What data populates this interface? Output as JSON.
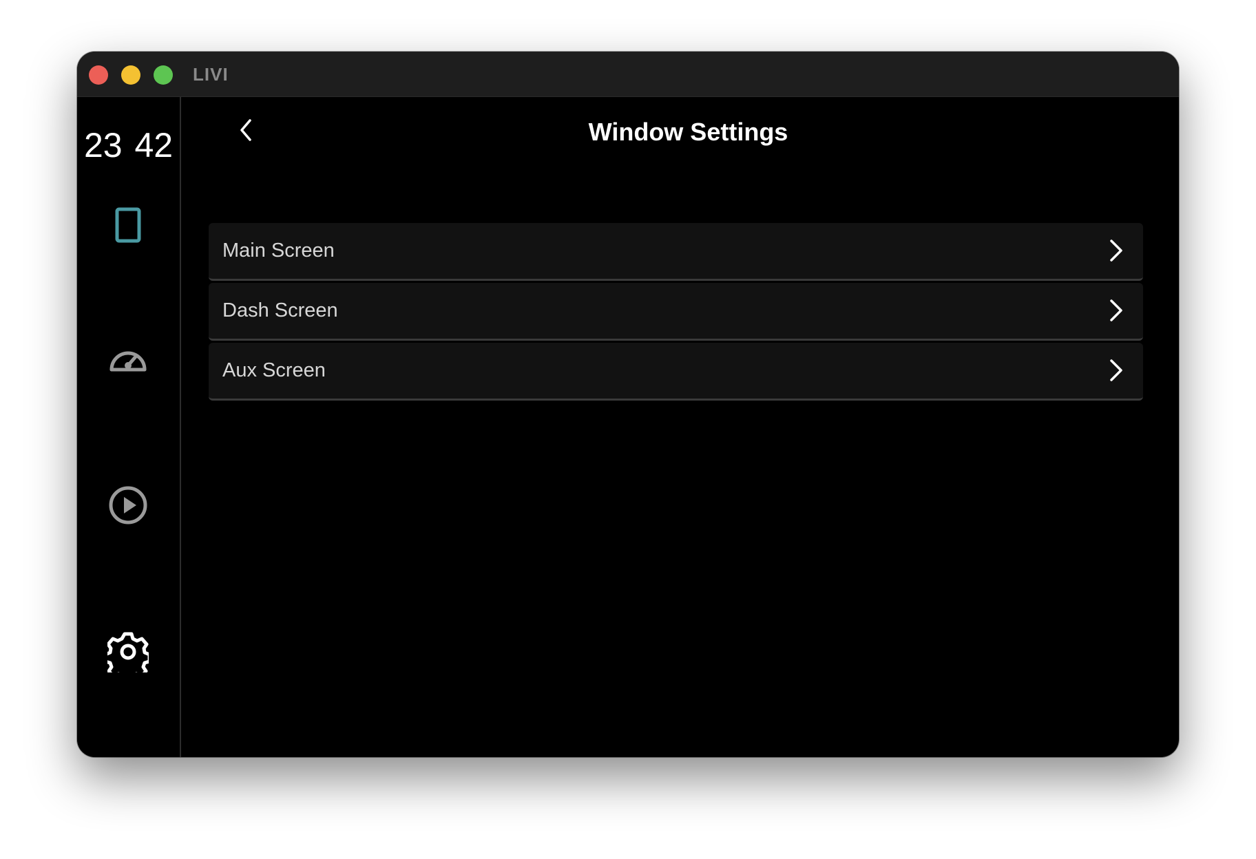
{
  "window": {
    "title": "LIVI"
  },
  "sidebar": {
    "clock": "23 42",
    "items": [
      {
        "icon": "phone-icon",
        "color": "#4a9aa3"
      },
      {
        "icon": "speedometer-icon",
        "color": "#9a9a9a"
      },
      {
        "icon": "play-circle-icon",
        "color": "#9a9a9a"
      },
      {
        "icon": "gear-icon",
        "color": "#ffffff"
      }
    ]
  },
  "main": {
    "title": "Window Settings",
    "items": [
      {
        "label": "Main Screen"
      },
      {
        "label": "Dash Screen"
      },
      {
        "label": "Aux Screen"
      }
    ]
  },
  "colors": {
    "accent": "#4a9aa3",
    "background": "#000000",
    "titlebar": "#1e1e1e",
    "list_item_bg": "#121212"
  }
}
